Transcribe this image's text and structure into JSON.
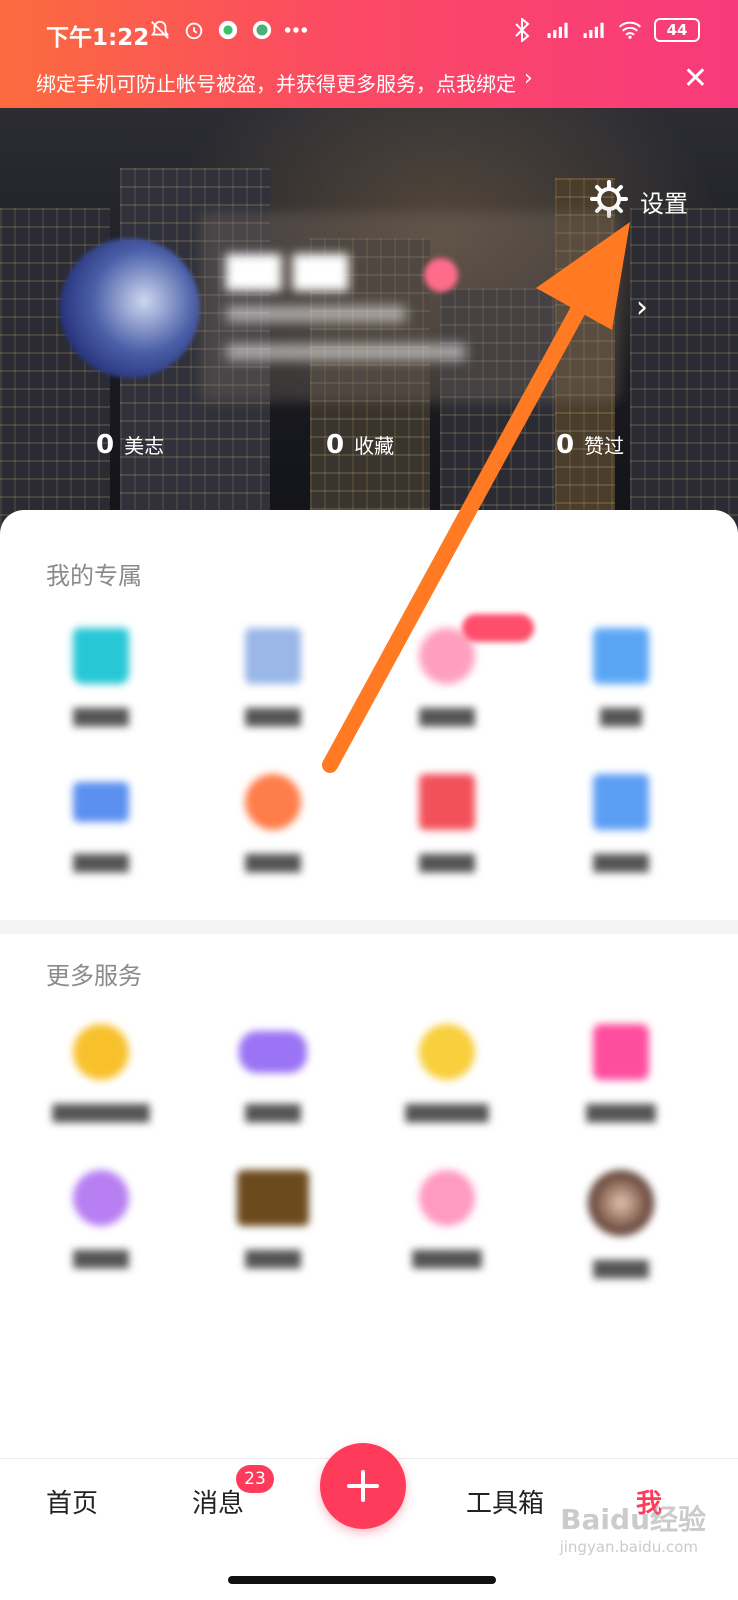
{
  "status_bar": {
    "time": "下午1:22",
    "battery": "44",
    "icons": [
      "bell-off-icon",
      "alarm-icon",
      "app-icon",
      "chat-icon",
      "more-dots-icon",
      "bluetooth-icon",
      "signal-hd-icon",
      "signal-hd-icon",
      "wifi-icon"
    ]
  },
  "bind_banner": {
    "text": "绑定手机可防止帐号被盗，并获得更多服务，点我绑定",
    "chevron": "›",
    "close": "✕"
  },
  "header": {
    "settings_label": "设置",
    "profile_chevron": "›",
    "stats": [
      {
        "value": "0",
        "label": "美志"
      },
      {
        "value": "0",
        "label": "收藏"
      },
      {
        "value": "0",
        "label": "赞过"
      }
    ]
  },
  "sections": {
    "exclusive_title": "我的专属",
    "more_services_title": "更多服务"
  },
  "bottom_nav": {
    "home": "首页",
    "messages": "消息",
    "messages_badge": "23",
    "toolbox": "工具箱",
    "me": "我"
  },
  "watermark": {
    "main": "Baidu经验",
    "sub": "jingyan.baidu.com"
  },
  "colors": {
    "accent": "#ff3b5c",
    "banner_start": "#fb6b3e",
    "banner_end": "#f83a7c",
    "arrow": "#ff7a22"
  }
}
